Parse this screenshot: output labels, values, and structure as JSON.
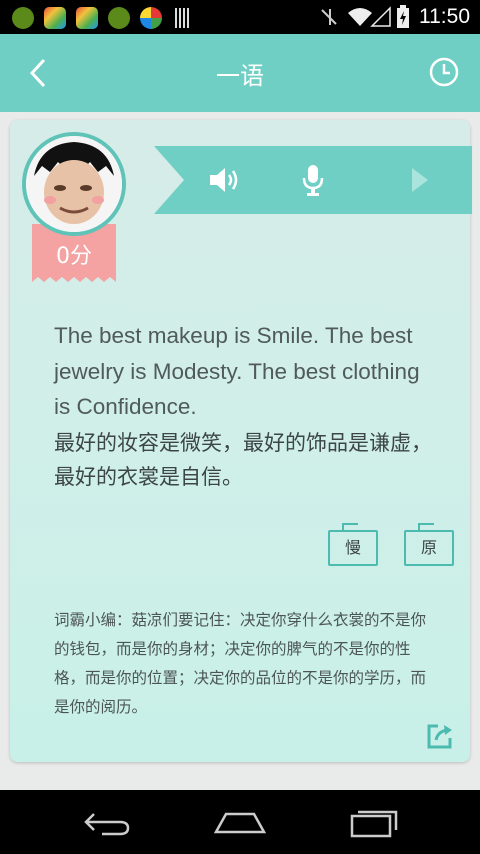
{
  "status_bar": {
    "time": "11:50",
    "icons": [
      "app-icon-1",
      "app-icon-2",
      "app-icon-3",
      "app-icon-4",
      "app-icon-5",
      "barcode-icon",
      "mute-icon",
      "wifi-icon",
      "signal-icon",
      "battery-icon"
    ]
  },
  "header": {
    "title": "一语",
    "back_icon": "back-arrow-icon",
    "history_icon": "clock-icon"
  },
  "profile": {
    "score": "0分"
  },
  "toolbar": {
    "icons": [
      "speaker-icon",
      "microphone-icon",
      "play-icon"
    ]
  },
  "quote": {
    "english": "The best makeup is Smile. The best jewelry is Modesty. The best clothing is Confidence.",
    "chinese": "最好的妆容是微笑，最好的饰品是谦虚，最好的衣裳是自信。"
  },
  "playback": {
    "slow_label": "慢",
    "original_label": "原"
  },
  "editor_note": "词霸小编：菇凉们要记住：决定你穿什么衣裳的不是你的钱包，而是你的身材；决定你的脾气的不是你的性格，而是你的位置；决定你的品位的不是你的学历，而是你的阅历。",
  "colors": {
    "accent": "#6fcfc4",
    "ribbon": "#f4a2a2",
    "card": "#d0efe9"
  }
}
